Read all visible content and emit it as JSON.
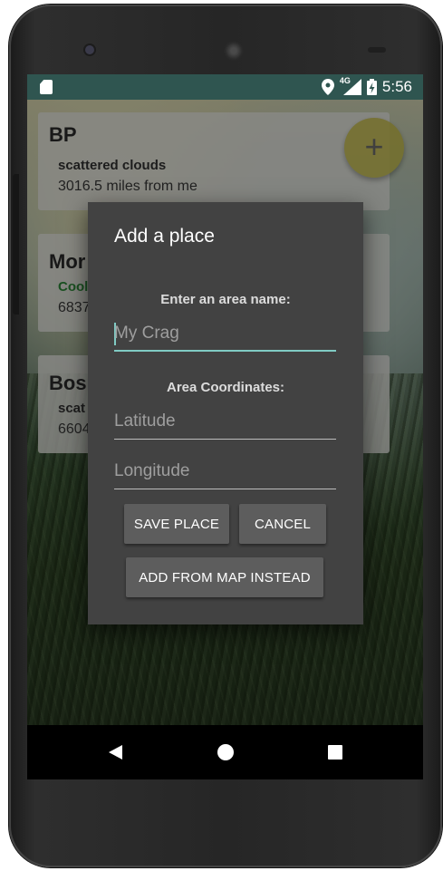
{
  "status_bar": {
    "network": "4G",
    "time": "5:56",
    "icons": [
      "sd-card-icon",
      "location-icon",
      "signal-icon",
      "battery-charging-icon"
    ]
  },
  "places": [
    {
      "title": "BP",
      "weather": "scattered clouds",
      "distance": "3016.5 miles from me"
    },
    {
      "title": "Mor",
      "weather": "Cool",
      "distance": "6837"
    },
    {
      "title": "Bos",
      "weather": "scat",
      "distance": "6604"
    }
  ],
  "fab": {
    "label": "+",
    "color": "#c9c04a"
  },
  "dialog": {
    "title": "Add a place",
    "area_name_label": "Enter an area name:",
    "area_name_placeholder": "My Crag",
    "coordinates_label": "Area Coordinates:",
    "latitude_placeholder": "Latitude",
    "longitude_placeholder": "Longitude",
    "save_button": "SAVE PLACE",
    "cancel_button": "CANCEL",
    "add_from_map_button": "ADD FROM MAP INSTEAD"
  },
  "colors": {
    "accent": "#80cbc4",
    "dialog_background": "#424242",
    "status_bar": "#2f5550",
    "weather_green": "#2e8b3a"
  },
  "nav": {
    "icons": [
      "back-icon",
      "home-icon",
      "recents-icon"
    ]
  }
}
